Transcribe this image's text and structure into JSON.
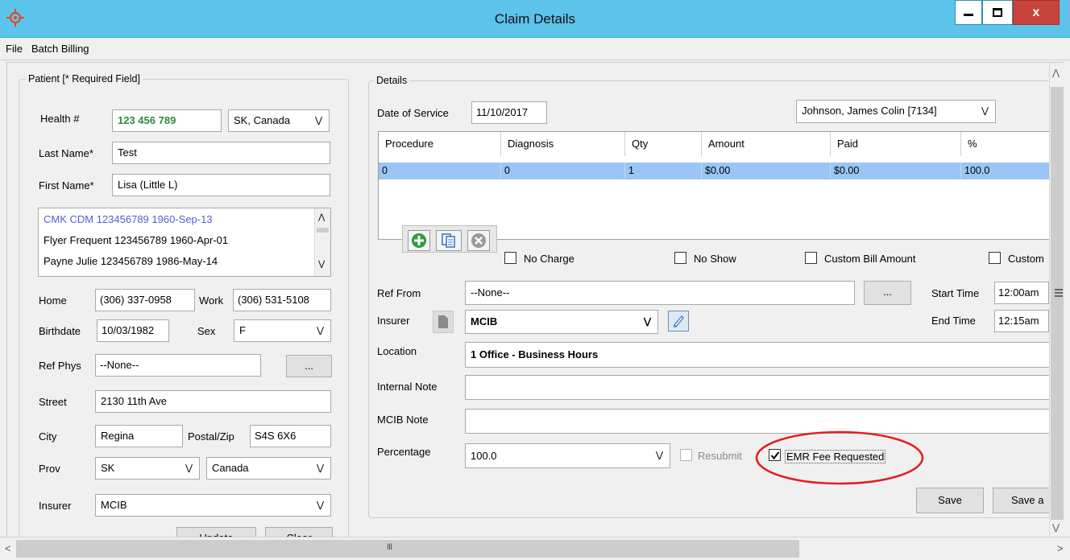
{
  "window": {
    "title": "Claim Details",
    "close_label": "x"
  },
  "menu": [
    "File",
    "Batch Billing"
  ],
  "patient": {
    "group_label": "Patient [* Required Field]",
    "health_label": "Health #",
    "health_value": "123 456 789",
    "health_region": "SK, Canada",
    "last_name_label": "Last Name*",
    "last_name": "Test",
    "first_name_label": "First Name*",
    "first_name": "Lisa (Little L)",
    "matches": [
      "CMK  CDM  123456789  1960-Sep-13",
      "Flyer  Frequent  123456789  1960-Apr-01",
      "Payne  Julie  123456789  1986-May-14"
    ],
    "home_label": "Home",
    "home": "(306) 337-0958",
    "work_label": "Work",
    "work": "(306) 531-5108",
    "birthdate_label": "Birthdate",
    "birthdate": "10/03/1982",
    "sex_label": "Sex",
    "sex": "F",
    "ref_phys_label": "Ref Phys",
    "ref_phys": "--None--",
    "ellipsis": "...",
    "street_label": "Street",
    "street": "2130 11th Ave",
    "city_label": "City",
    "city": "Regina",
    "postal_label": "Postal/Zip",
    "postal": "S4S 6X6",
    "prov_label": "Prov",
    "prov": "SK",
    "country": "Canada",
    "insurer_label": "Insurer",
    "insurer": "MCIB",
    "update_label": "Update",
    "clear_label": "Clear"
  },
  "details": {
    "group_label": "Details",
    "dos_label": "Date of Service",
    "dos": "11/10/2017",
    "provider": "Johnson, James Colin [7134]",
    "columns": [
      "Procedure",
      "Diagnosis",
      "Qty",
      "Amount",
      "Paid",
      "%"
    ],
    "row": [
      "0",
      "0",
      "1",
      "$0.00",
      "$0.00",
      "100.0"
    ],
    "no_charge": "No Charge",
    "no_show": "No Show",
    "custom_bill_amount": "Custom Bill Amount",
    "custom_cut": "Custom",
    "ref_from_label": "Ref From",
    "ref_from": "--None--",
    "ellipsis": "...",
    "start_time_label": "Start Time",
    "start_time": "12:00am",
    "end_time_label": "End Time",
    "end_time": "12:15am",
    "insurer_label": "Insurer",
    "insurer": "MCIB",
    "location_label": "Location",
    "location": "1  Office  -  Business Hours",
    "internal_note_label": "Internal Note",
    "internal_note": "",
    "mcib_note_label": "MCIB Note",
    "mcib_note": "",
    "percentage_label": "Percentage",
    "percentage": "100.0",
    "resubmit_label": "Resubmit",
    "emr_fee_label": "EMR Fee Requested",
    "emr_fee_checked": true,
    "save_label": "Save",
    "save_and_label": "Save a"
  },
  "scroll": {
    "h_thumb_glyph": "III"
  },
  "colors": {
    "titlebar": "#5cc3ea",
    "highlight_row": "#9ac5f6",
    "health_text": "#2e8b3e",
    "match_text": "#5a5ad8",
    "annotation": "#e02020"
  }
}
